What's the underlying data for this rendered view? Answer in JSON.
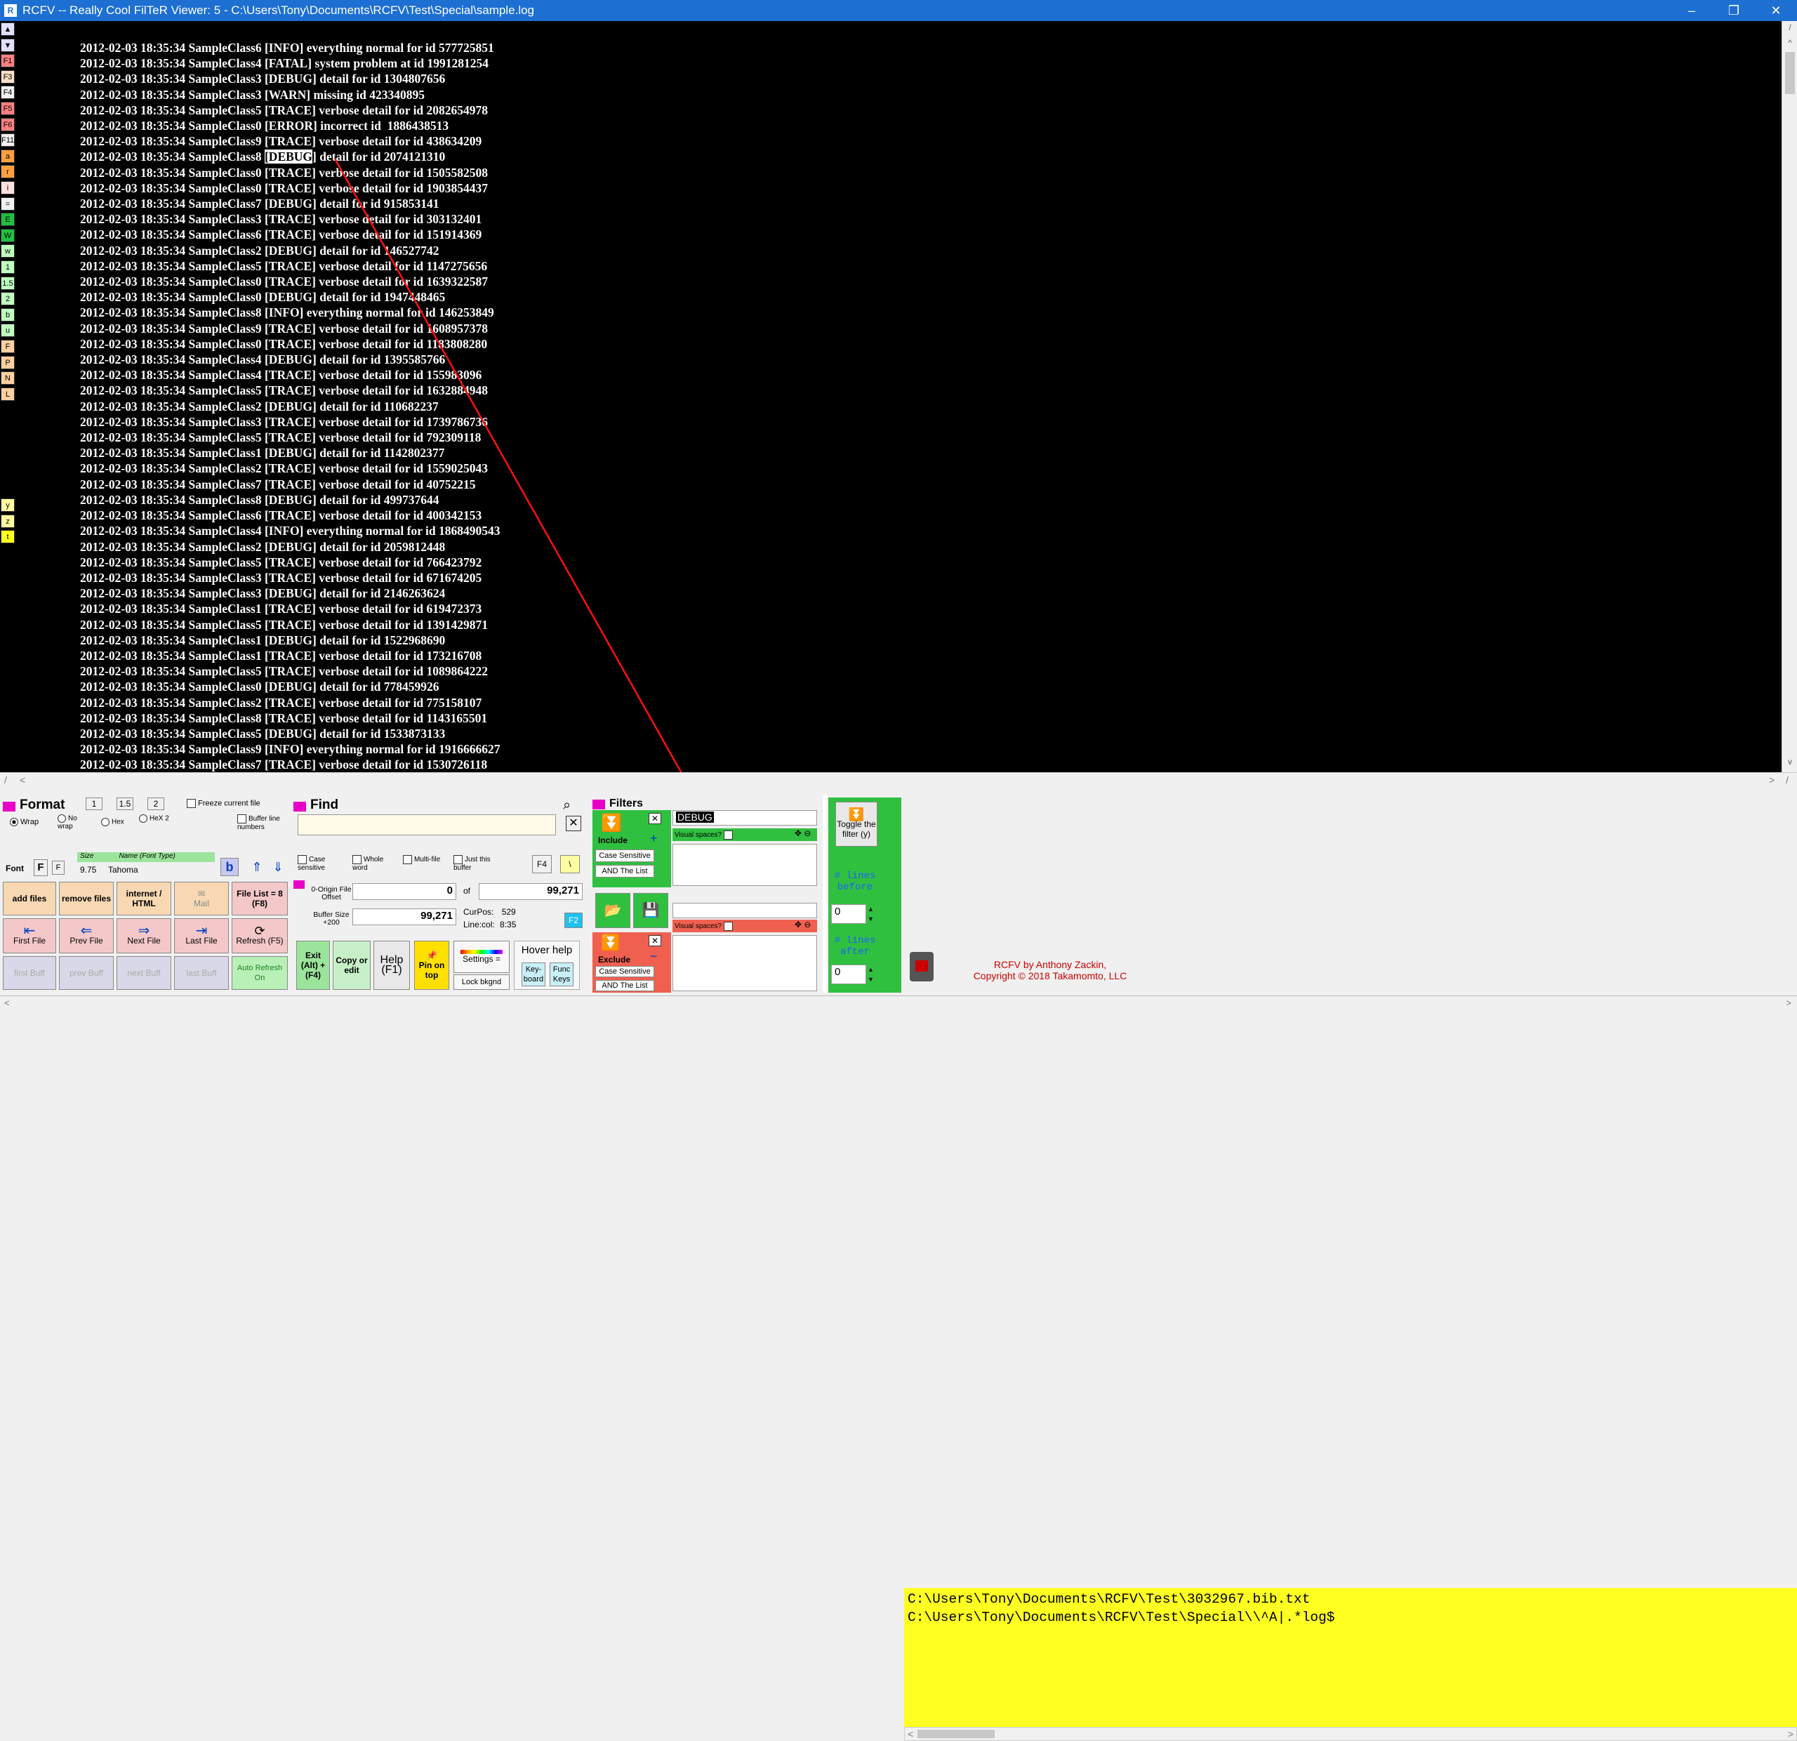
{
  "window": {
    "title": "RCFV -- Really Cool FilTeR Viewer: 5 - C:\\Users\\Tony\\Documents\\RCFV\\Test\\Special\\sample.log",
    "app_icon": "rcfv-app-icon",
    "minimize": "–",
    "restore": "❐",
    "close": "✕"
  },
  "left_strip": [
    {
      "label": "▲",
      "color": "#e0e0ff"
    },
    {
      "label": "▼",
      "color": "#e0e0ff"
    },
    {
      "label": "F1",
      "color": "#ff8080"
    },
    {
      "label": "F3",
      "color": "#f8e0c8"
    },
    {
      "label": "F4",
      "color": "#f0f0f0"
    },
    {
      "label": "F5",
      "color": "#ff8080"
    },
    {
      "label": "F6",
      "color": "#ff8080"
    },
    {
      "label": "F11",
      "color": "#f0f0f0"
    },
    {
      "label": "a",
      "color": "#ffa040"
    },
    {
      "label": "r",
      "color": "#ffa040"
    },
    {
      "label": "i",
      "color": "#ffe0e0"
    },
    {
      "label": "=",
      "color": "#f0f0f0"
    },
    {
      "label": "E",
      "color": "#20c040"
    },
    {
      "label": "W",
      "color": "#20c040"
    },
    {
      "label": "w",
      "color": "#c0ffc0"
    },
    {
      "label": "1",
      "color": "#c0ffc0"
    },
    {
      "label": "1.5",
      "color": "#c0ffc0"
    },
    {
      "label": "2",
      "color": "#c0ffc0"
    },
    {
      "label": "b",
      "color": "#c0ffc0"
    },
    {
      "label": "u",
      "color": "#c0ffc0"
    },
    {
      "label": "F",
      "color": "#ffd0a0"
    },
    {
      "label": "P",
      "color": "#ffd0a0"
    },
    {
      "label": "N",
      "color": "#ffd0a0"
    },
    {
      "label": "L",
      "color": "#ffd0a0"
    },
    {
      "label": "y",
      "color": "#ffffa0"
    },
    {
      "label": "z",
      "color": "#ffffa0"
    },
    {
      "label": "t",
      "color": "#ffff20"
    }
  ],
  "log_lines": [
    "2012-02-03 18:35:34 SampleClass6 [INFO] everything normal for id 577725851",
    "2012-02-03 18:35:34 SampleClass4 [FATAL] system problem at id 1991281254",
    "2012-02-03 18:35:34 SampleClass3 [DEBUG] detail for id 1304807656",
    "2012-02-03 18:35:34 SampleClass3 [WARN] missing id 423340895",
    "2012-02-03 18:35:34 SampleClass5 [TRACE] verbose detail for id 2082654978",
    "2012-02-03 18:35:34 SampleClass0 [ERROR] incorrect id  1886438513",
    "2012-02-03 18:35:34 SampleClass9 [TRACE] verbose detail for id 438634209",
    "2012-02-03 18:35:34 SampleClass8 [DEBUG] detail for id 2074121310",
    "2012-02-03 18:35:34 SampleClass0 [TRACE] verbose detail for id 1505582508",
    "2012-02-03 18:35:34 SampleClass0 [TRACE] verbose detail for id 1903854437",
    "2012-02-03 18:35:34 SampleClass7 [DEBUG] detail for id 915853141",
    "2012-02-03 18:35:34 SampleClass3 [TRACE] verbose detail for id 303132401",
    "2012-02-03 18:35:34 SampleClass6 [TRACE] verbose detail for id 151914369",
    "2012-02-03 18:35:34 SampleClass2 [DEBUG] detail for id 146527742",
    "2012-02-03 18:35:34 SampleClass5 [TRACE] verbose detail for id 1147275656",
    "2012-02-03 18:35:34 SampleClass0 [TRACE] verbose detail for id 1639322587",
    "2012-02-03 18:35:34 SampleClass0 [DEBUG] detail for id 1947448465",
    "2012-02-03 18:35:34 SampleClass8 [INFO] everything normal for id 146253849",
    "2012-02-03 18:35:34 SampleClass9 [TRACE] verbose detail for id 1608957378",
    "2012-02-03 18:35:34 SampleClass0 [TRACE] verbose detail for id 1183808280",
    "2012-02-03 18:35:34 SampleClass4 [DEBUG] detail for id 1395585766",
    "2012-02-03 18:35:34 SampleClass4 [TRACE] verbose detail for id 155983096",
    "2012-02-03 18:35:34 SampleClass5 [TRACE] verbose detail for id 1632884948",
    "2012-02-03 18:35:34 SampleClass2 [DEBUG] detail for id 110682237",
    "2012-02-03 18:35:34 SampleClass3 [TRACE] verbose detail for id 1739786736",
    "2012-02-03 18:35:34 SampleClass5 [TRACE] verbose detail for id 792309118",
    "2012-02-03 18:35:34 SampleClass1 [DEBUG] detail for id 1142802377",
    "2012-02-03 18:35:34 SampleClass2 [TRACE] verbose detail for id 1559025043",
    "2012-02-03 18:35:34 SampleClass7 [TRACE] verbose detail for id 40752215",
    "2012-02-03 18:35:34 SampleClass8 [DEBUG] detail for id 499737644",
    "2012-02-03 18:35:34 SampleClass6 [TRACE] verbose detail for id 400342153",
    "2012-02-03 18:35:34 SampleClass4 [INFO] everything normal for id 1868490543",
    "2012-02-03 18:35:34 SampleClass2 [DEBUG] detail for id 2059812448",
    "2012-02-03 18:35:34 SampleClass5 [TRACE] verbose detail for id 766423792",
    "2012-02-03 18:35:34 SampleClass3 [TRACE] verbose detail for id 671674205",
    "2012-02-03 18:35:34 SampleClass3 [DEBUG] detail for id 2146263624",
    "2012-02-03 18:35:34 SampleClass1 [TRACE] verbose detail for id 619472373",
    "2012-02-03 18:35:34 SampleClass5 [TRACE] verbose detail for id 1391429871",
    "2012-02-03 18:35:34 SampleClass1 [DEBUG] detail for id 1522968690",
    "2012-02-03 18:35:34 SampleClass1 [TRACE] verbose detail for id 173216708",
    "2012-02-03 18:35:34 SampleClass5 [TRACE] verbose detail for id 1089864222",
    "2012-02-03 18:35:34 SampleClass0 [DEBUG] detail for id 778459926",
    "2012-02-03 18:35:34 SampleClass2 [TRACE] verbose detail for id 775158107",
    "2012-02-03 18:35:34 SampleClass8 [TRACE] verbose detail for id 1143165501",
    "2012-02-03 18:35:34 SampleClass5 [DEBUG] detail for id 1533873133",
    "2012-02-03 18:35:34 SampleClass9 [INFO] everything normal for id 1916666627",
    "2012-02-03 18:35:34 SampleClass7 [TRACE] verbose detail for id 1530726118"
  ],
  "selected_word": "DEBUG",
  "scroll": {
    "left_mark": "/",
    "right_mark": "/",
    "left_arrow": "<",
    "right_arrow": ">",
    "up_arrow": "^",
    "down_arrow": "v"
  },
  "format": {
    "title": "Format",
    "spacing": [
      "1",
      "1.5",
      "2"
    ],
    "freeze": "Freeze current file",
    "wrap": "Wrap",
    "nowrap": "No wrap",
    "hex": "Hex",
    "hex2": "HeX 2",
    "buffer_line_numbers": "Buffer line numbers",
    "font_label": "Font",
    "font_b": "F",
    "font_s": "F",
    "size_label": "Size",
    "name_label": "Name (Font Type)",
    "size_value": "9.75",
    "font_name": "Tahoma",
    "bold_btn": "b"
  },
  "file_buttons": {
    "add": "add files",
    "remove": "remove files",
    "internet": "internet / HTML",
    "mail": "Mail",
    "file_list": "File List = 8 (F8)",
    "first": "First File",
    "prev": "Prev File",
    "next": "Next File",
    "last": "Last File",
    "refresh": "Refresh (F5)",
    "first_buff": "first Buff",
    "prev_buff": "prev Buff",
    "next_buff": "next Buff",
    "last_buff": "last Buff",
    "auto_refresh": "Auto Refresh On"
  },
  "find": {
    "title": "Find",
    "value": "",
    "case": "Case sensitive",
    "whole": "Whole word",
    "multi": "Multi-file",
    "just": "Just this buffer",
    "f4": "F4",
    "f3": "\\",
    "origin_label": "0-Origin File Offset",
    "origin_value": "0",
    "of_label": "of",
    "of_value": "99,271",
    "buffer_label": "Buffer Size +200",
    "buffer_value": "99,271",
    "curpos_label": "CurPos:",
    "curpos_value": "529",
    "linecol_label": "Line:col:",
    "linecol_value": "8:35",
    "f2": "F2"
  },
  "bottom_buttons": {
    "exit": "Exit (Alt) + (F4)",
    "copy": "Copy or edit",
    "help": "Help (F1)",
    "pin": "Pin on top",
    "settings": "Settings =",
    "lock": "Lock bkgnd",
    "hover": "Hover help",
    "keyboard": "Key-board",
    "func": "Func Keys"
  },
  "filters": {
    "title": "Filters",
    "include": "Include",
    "exclude": "Exclude",
    "case": "Case Sensitive",
    "and": "AND The List",
    "include_value": "DEBUG",
    "visual": "Visual spaces?",
    "toggle": "Toggle the filter (y)",
    "lines_before": "# lines before",
    "lines_after": "# lines after",
    "before_value": "0",
    "after_value": "0"
  },
  "file_paths": [
    "C:\\Users\\Tony\\Documents\\RCFV\\Test\\3032967.bib.txt",
    "C:\\Users\\Tony\\Documents\\RCFV\\Test\\Special\\\\^A|.*log$"
  ],
  "credit": {
    "line1": "RCFV by Anthony Zackin,",
    "line2": "Copyright © 2018 Takamomto, LLC"
  },
  "colors": {
    "accent": "#e800c8",
    "log_bg": "#000000",
    "paths_bg": "#ffff22",
    "titlebar": "#1d6fd2",
    "credit": "#cc0000"
  }
}
